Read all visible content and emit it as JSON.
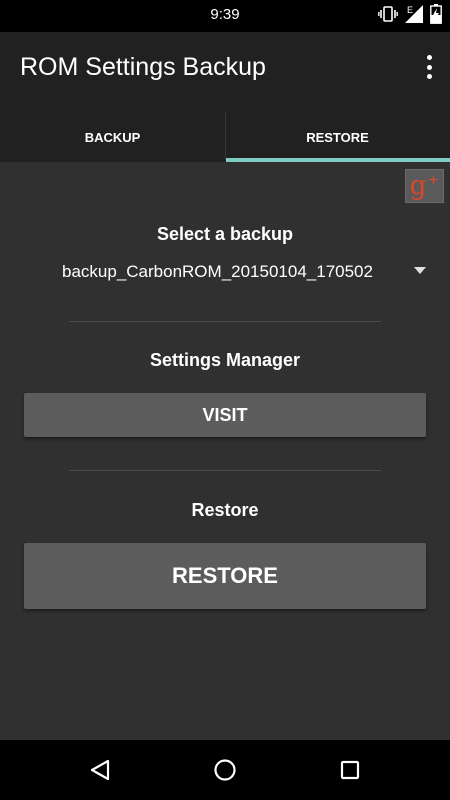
{
  "status_bar": {
    "time": "9:39",
    "icons": [
      "vibrate-icon",
      "signal-icon",
      "battery-charging-icon"
    ]
  },
  "app_bar": {
    "title": "ROM Settings Backup",
    "overflow_icon": "more-vert-icon"
  },
  "tabs": [
    {
      "label": "BACKUP",
      "selected": false
    },
    {
      "label": "RESTORE",
      "selected": true
    }
  ],
  "colors": {
    "tab_indicator": "#80cbc4",
    "background": "#303030",
    "toolbar": "#212121",
    "button": "#5c5c5c",
    "google_plus_glyph": "#e0452b"
  },
  "google_plus": {
    "glyph": "g",
    "sup": "+"
  },
  "select_backup": {
    "heading": "Select a backup",
    "selected_value": "backup_CarbonROM_20150104_170502"
  },
  "settings_manager": {
    "heading": "Settings Manager",
    "button_label": "VISIT"
  },
  "restore": {
    "heading": "Restore",
    "button_label": "RESTORE"
  },
  "nav_bar": {
    "buttons": [
      "back-icon",
      "home-icon",
      "recents-icon"
    ]
  }
}
